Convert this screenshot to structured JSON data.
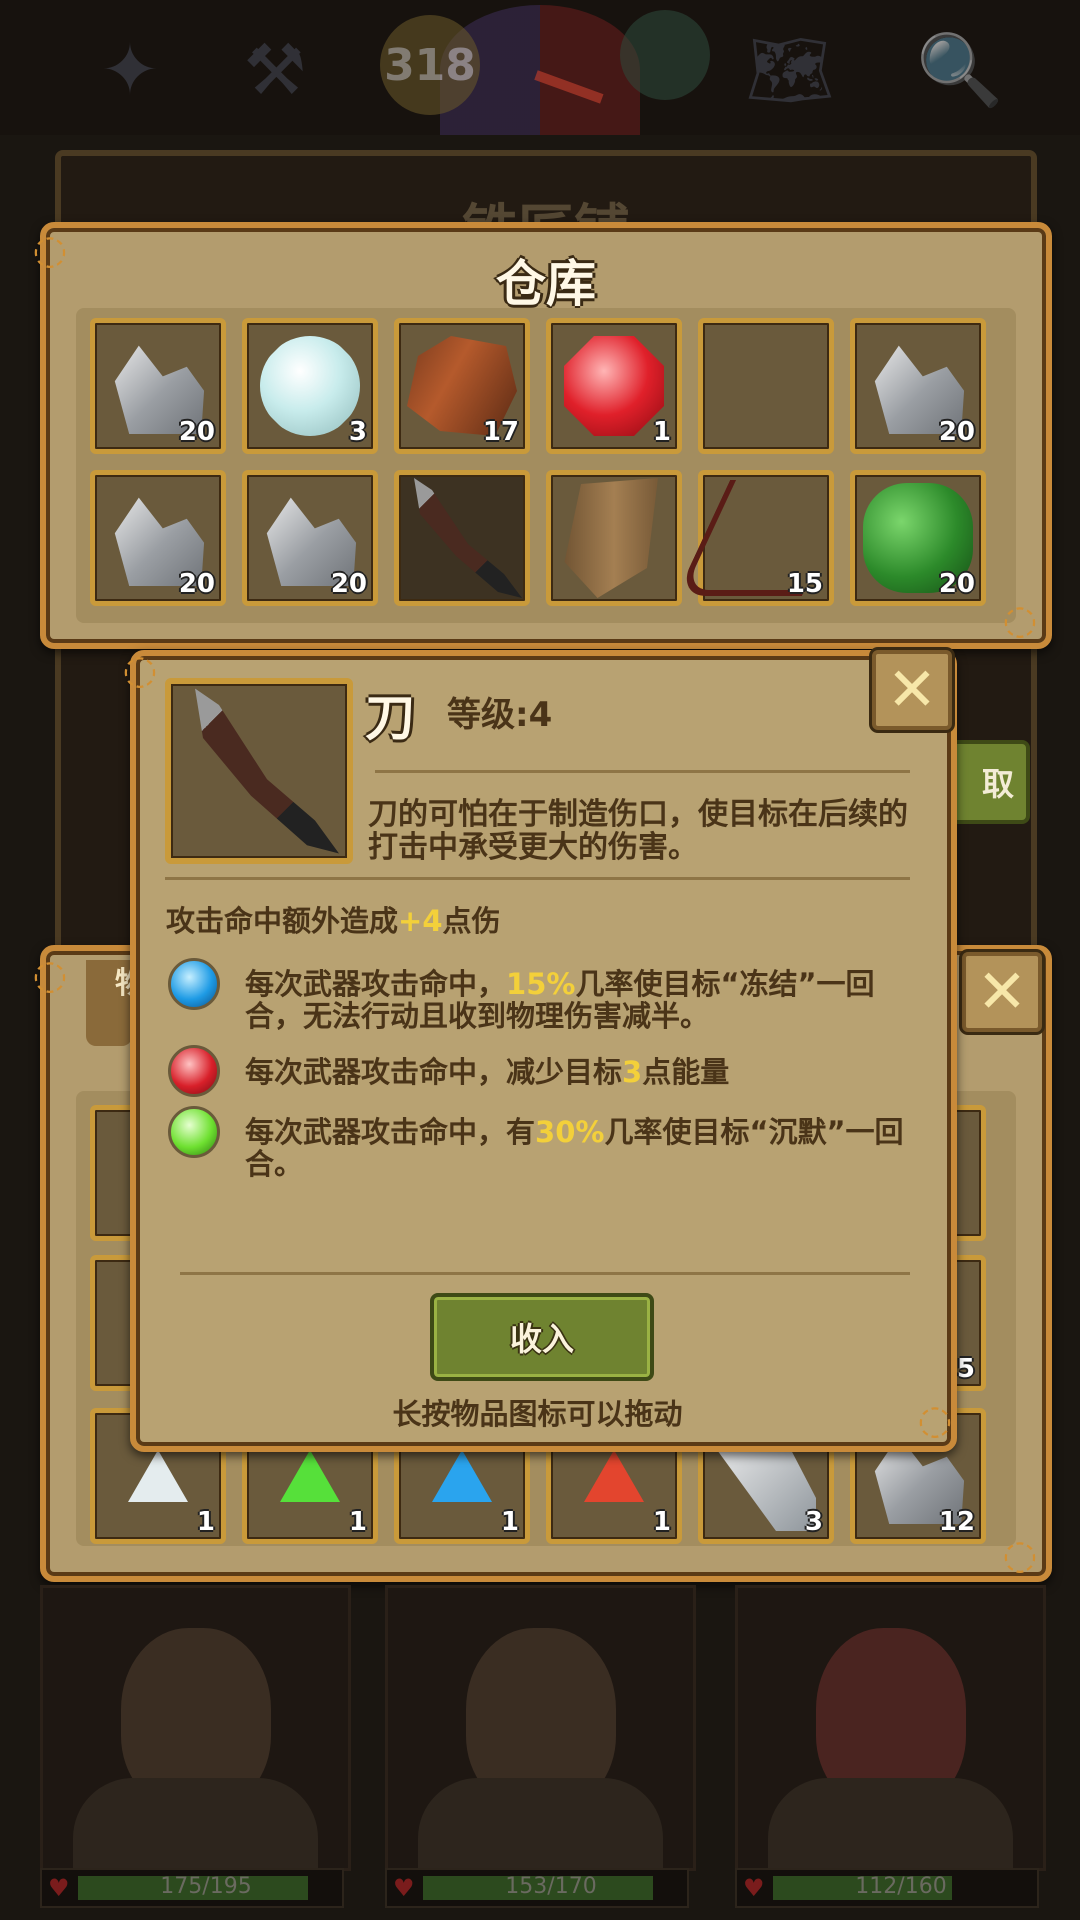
{
  "hud": {
    "day_count": "318",
    "icons": [
      "wings-icon",
      "anvil-icon",
      "compass-icon",
      "weather-icon",
      "map-icon",
      "magnifier-icon"
    ]
  },
  "backdrop": {
    "title": "铁匠铺",
    "take_button": "取"
  },
  "warehouse": {
    "title": "仓库",
    "slots": [
      {
        "item": "stone",
        "count": "20"
      },
      {
        "item": "diamond",
        "count": "3"
      },
      {
        "item": "wood",
        "count": "17"
      },
      {
        "item": "ruby",
        "count": "1"
      },
      {
        "item": "empty",
        "count": ""
      },
      {
        "item": "stone",
        "count": "20"
      },
      {
        "item": "stone",
        "count": "20"
      },
      {
        "item": "stone",
        "count": "20"
      },
      {
        "item": "knife",
        "count": ""
      },
      {
        "item": "shield",
        "count": ""
      },
      {
        "item": "branch",
        "count": "15"
      },
      {
        "item": "herb",
        "count": "20"
      }
    ]
  },
  "item_panel": {
    "name": "刀",
    "level": "等级:4",
    "description": "刀的可怕在于制造伤口，使目标在后续的打击中承受更大的伤害。",
    "bonus_prefix": "攻击命中额外造成",
    "bonus_value": "+4",
    "bonus_suffix": "点伤",
    "effects": [
      {
        "gem": "blue",
        "pre": "每次武器攻击命中，",
        "hl": "15%",
        "post": "几率使目标“冻结”一回合，无法行动且收到物理伤害减半。"
      },
      {
        "gem": "red",
        "pre": "每次武器攻击命中，减少目标",
        "hl": "3",
        "post": "点能量"
      },
      {
        "gem": "green",
        "pre": "每次武器攻击命中，有",
        "hl": "30%",
        "post": "几率使目标“沉默”一回合。"
      }
    ],
    "store_button": "收入",
    "hint": "长按物品图标可以拖动"
  },
  "bag_bottom_row": [
    {
      "item": "white-gem",
      "count": "1"
    },
    {
      "item": "green-gem",
      "count": "1"
    },
    {
      "item": "blue-gem",
      "count": "1"
    },
    {
      "item": "red-gem",
      "count": "1"
    },
    {
      "item": "iron-bar",
      "count": "3"
    },
    {
      "item": "stone",
      "count": "12"
    }
  ],
  "bag_partial": {
    "tab_label": "物",
    "right_count": "5"
  },
  "party": [
    {
      "hp": "175/195",
      "fill": 0.897
    },
    {
      "hp": "153/170",
      "fill": 0.9
    },
    {
      "hp": "112/160",
      "fill": 0.7
    }
  ]
}
